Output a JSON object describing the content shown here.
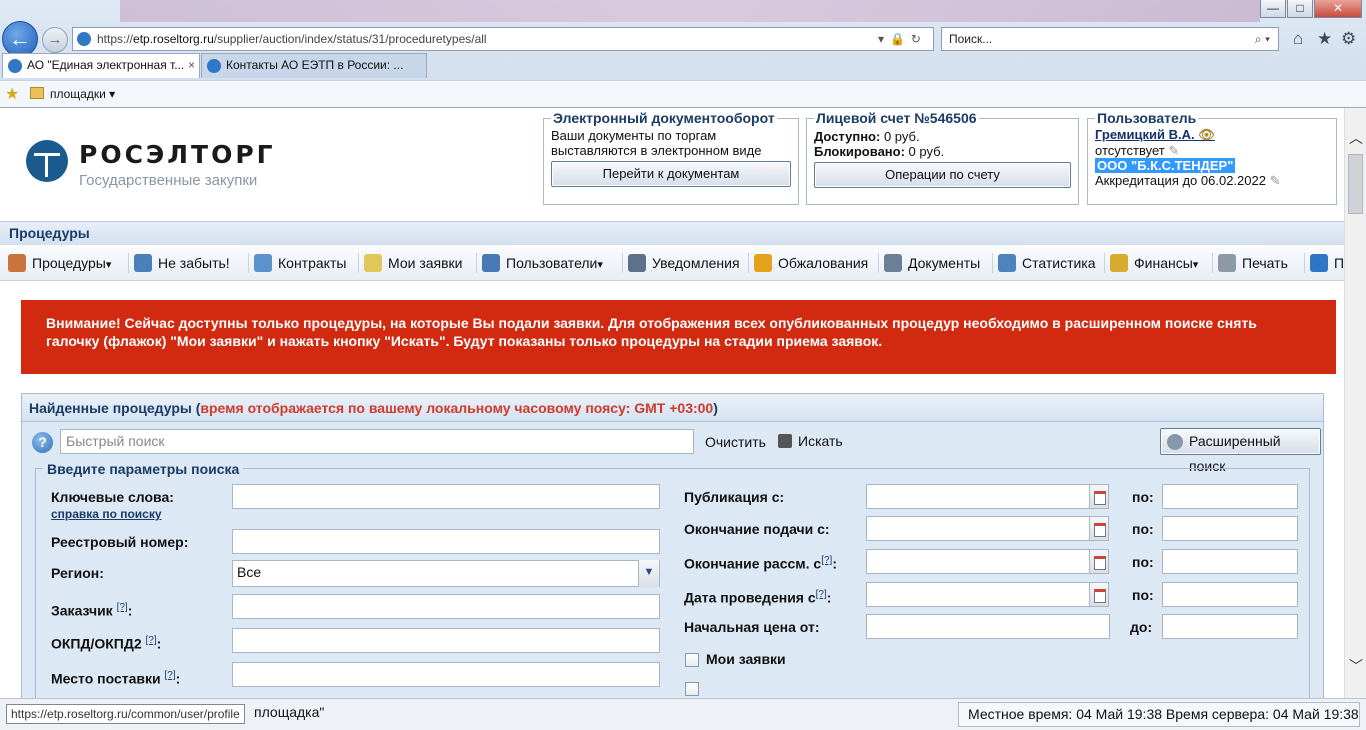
{
  "browser": {
    "address": {
      "scheme": "https://",
      "host": "etp.roseltorg.ru",
      "path": "/supplier/auction/index/status/31/proceduretypes/all"
    },
    "search_placeholder": "Поиск...",
    "tabs": [
      {
        "label": "АО \"Единая электронная т...",
        "active": true
      },
      {
        "label": "Контакты АО ЕЭТП в России: ...",
        "active": false
      }
    ],
    "favorites": {
      "folder_label": "площадки"
    },
    "window_buttons": {
      "minimize": "—",
      "maximize": "□",
      "close": "✕"
    }
  },
  "header": {
    "logo_name": "РОСЭЛТОРГ",
    "logo_subtitle": "Государственные закупки",
    "edo": {
      "title": "Электронный документооборот",
      "line1": "Ваши документы по торгам",
      "line2": "выставляются в электронном виде",
      "button": "Перейти к документам"
    },
    "account": {
      "title": "Лицевой счет №546506",
      "available_label": "Доступно:",
      "available_value": " 0 руб.",
      "blocked_label": "Блокировано:",
      "blocked_value": " 0 руб.",
      "button": "Операции по счету"
    },
    "user": {
      "title": "Пользователь",
      "name": "Гремицкий В.А.",
      "status": "отсутствует",
      "org": "ООО \"Б.К.С.ТЕНДЕР\"",
      "accreditation": "Аккредитация до 06.02.2022"
    }
  },
  "section_title": "Процедуры",
  "menu": [
    {
      "label": "Процедуры",
      "color": "#c8743a",
      "caret": true
    },
    {
      "label": "Не забыть!",
      "color": "#4b7fb8",
      "caret": false
    },
    {
      "label": "Контракты",
      "color": "#5b92cc",
      "caret": false
    },
    {
      "label": "Мои заявки",
      "color": "#e0c75a",
      "caret": false
    },
    {
      "label": "Пользователи",
      "color": "#4a7ab5",
      "caret": true
    },
    {
      "label": "Уведомления",
      "color": "#5d7188",
      "caret": false
    },
    {
      "label": "Обжалования",
      "color": "#e3a21a",
      "caret": false
    },
    {
      "label": "Документы",
      "color": "#6c7f95",
      "caret": false
    },
    {
      "label": "Статистика",
      "color": "#4f83bd",
      "caret": false
    },
    {
      "label": "Финансы",
      "color": "#d7ab2b",
      "caret": true
    },
    {
      "label": "Печать",
      "color": "#8d99a7",
      "caret": false
    },
    {
      "label": "По",
      "color": "#2f77c5",
      "caret": false
    }
  ],
  "warning": "Внимание! Сейчас доступны только процедуры, на которые Вы подали заявки. Для отображения всех опубликованных процедур необходимо в расширенном поиске снять галочку (флажок) \"Мои заявки\" и нажать кнопку \"Искать\". Будут показаны только процедуры на стадии приема заявок.",
  "found": {
    "title": "Найденные процедуры (",
    "note": "время отображается по вашему локальному часовому поясу: GMT +03:00",
    "close_paren": ")",
    "quick_placeholder": "Быстрый поиск",
    "clear": "Очистить",
    "search": "Искать",
    "advanced": "Расширенный поиск"
  },
  "params": {
    "legend": "Введите параметры поиска",
    "keywords": "Ключевые слова:",
    "help_link": "справка по поиску",
    "registry": "Реестровый номер:",
    "region": "Регион:",
    "region_value": "Все",
    "customer": "Заказчик",
    "okpd": "ОКПД/ОКПД2",
    "delivery": "Место поставки",
    "hint": "[?]",
    "colon": ":",
    "published": "Публикация с:",
    "submit_end": "Окончание подачи с:",
    "review_end": "Окончание рассм. с",
    "held_date": "Дата проведения с",
    "start_price": "Начальная цена от:",
    "to1": "по:",
    "to2": "до:",
    "my_bids": "Мои заявки"
  },
  "status": {
    "url": "https://etp.roseltorg.ru/common/user/profile",
    "text": "площадка\"",
    "time": "Местное время: 04 Май 19:38 Время сервера: 04 Май 19:38"
  }
}
